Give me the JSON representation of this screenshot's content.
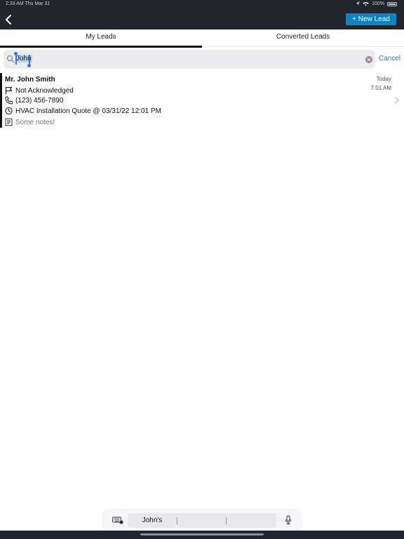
{
  "status_bar": {
    "time": "2:33 AM   Thu Mar 31",
    "battery": "100%"
  },
  "header": {
    "new_lead_label": "+ New Lead",
    "accent": "#0a84c6"
  },
  "tabs": [
    {
      "label": "My Leads",
      "active": true
    },
    {
      "label": "Converted Leads",
      "active": false
    }
  ],
  "search": {
    "value": "John",
    "cancel_label": "Cancel"
  },
  "leads": [
    {
      "name": "Mr. John Smith",
      "status": "Not Acknowledged",
      "phone": "(123) 456-7890",
      "appointment": "HVAC Installation Quote @ 03/31/22 12:01 PM",
      "notes": "Some notes!",
      "date": "Today",
      "time": "7:01 AM"
    }
  ],
  "keyboard": {
    "suggestions": [
      "John's",
      "",
      ""
    ]
  }
}
